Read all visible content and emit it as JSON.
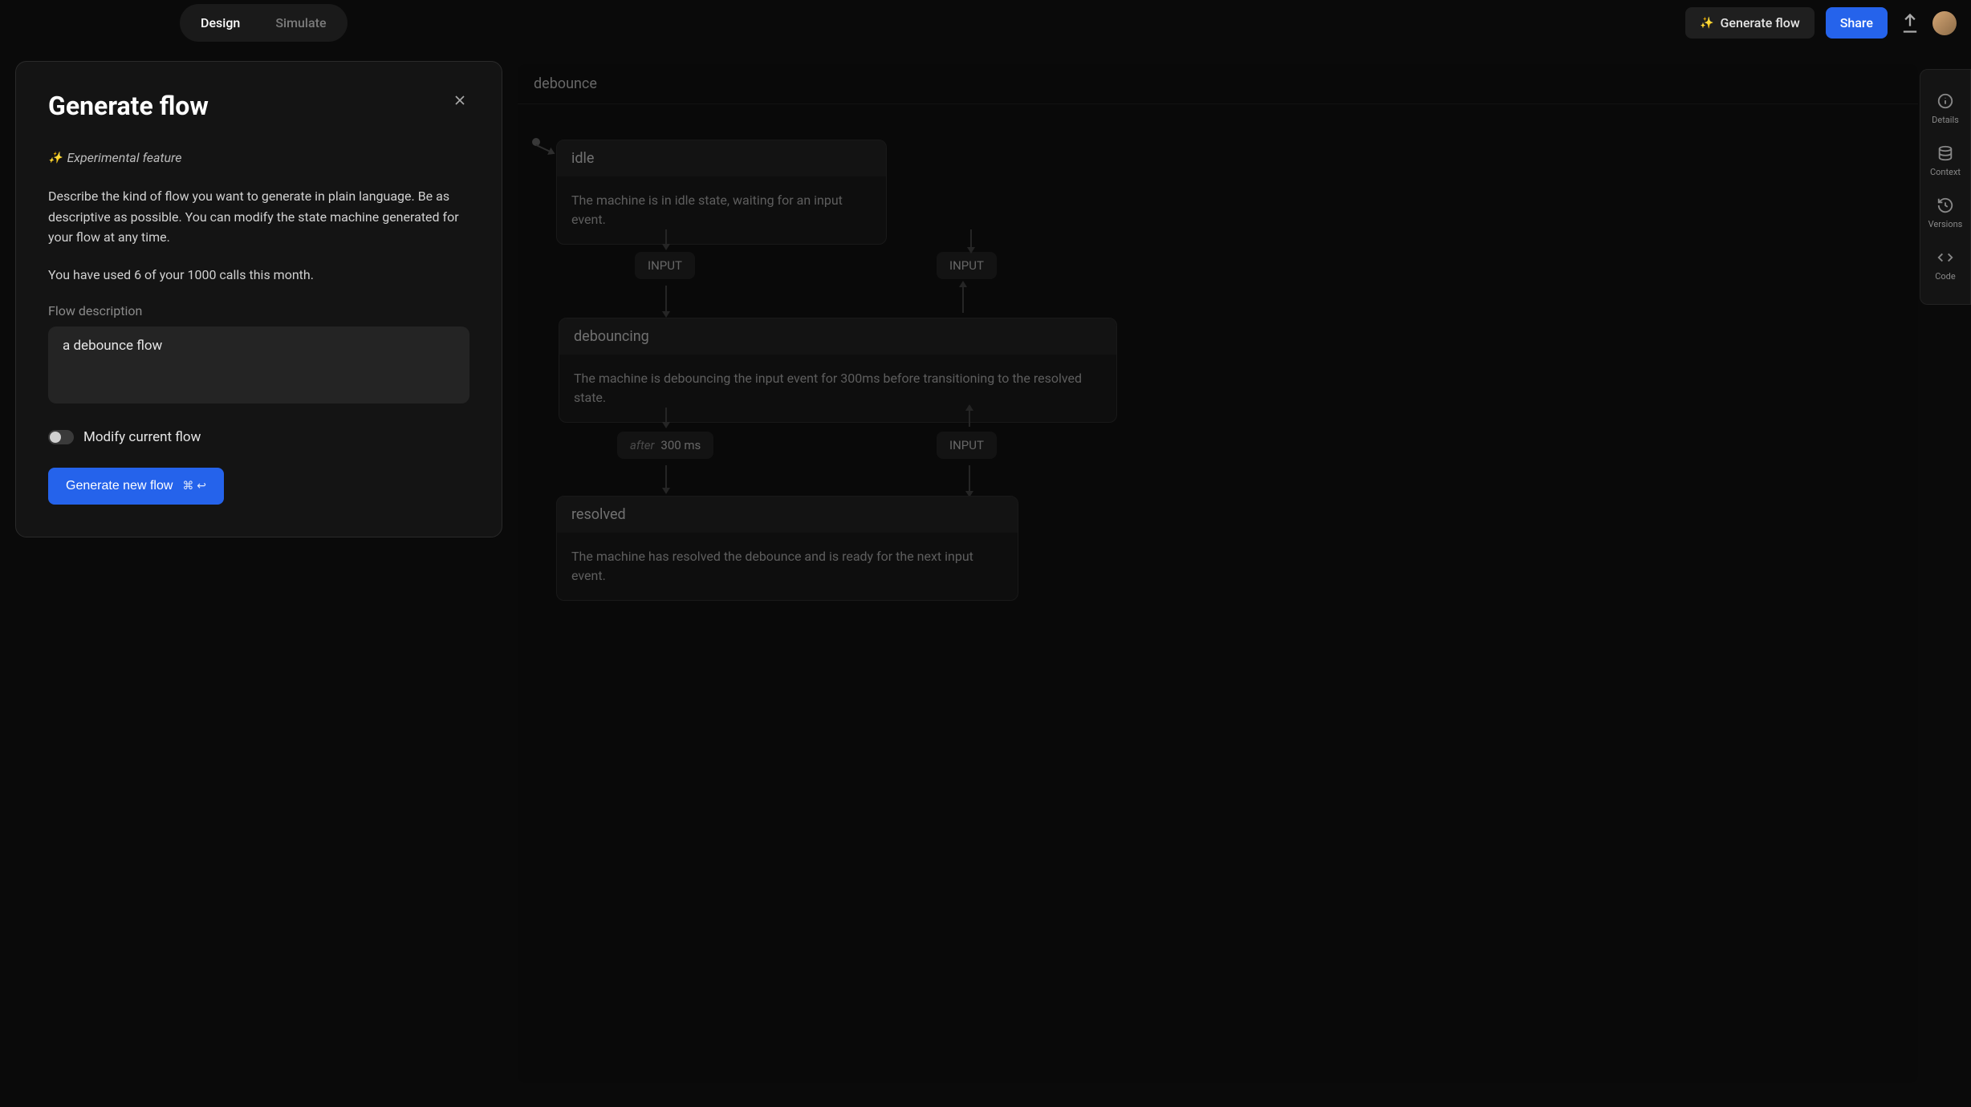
{
  "topbar": {
    "tabs": {
      "design": "Design",
      "simulate": "Simulate"
    },
    "generate_flow": "Generate flow",
    "share": "Share"
  },
  "dialog": {
    "title": "Generate flow",
    "experimental": "Experimental feature",
    "description": "Describe the kind of flow you want to generate in plain language. Be as descriptive as possible. You can modify the state machine generated for your flow at any time.",
    "usage": "You have used 6 of your 1000 calls this month.",
    "flow_description_label": "Flow description",
    "flow_description_value": "a debounce flow",
    "modify_label": "Modify current flow",
    "generate_btn": "Generate new flow",
    "shortcut": "⌘ ↩"
  },
  "machine": {
    "name": "debounce",
    "states": {
      "idle": {
        "name": "idle",
        "desc": "The machine is in idle state, waiting for an input event."
      },
      "debouncing": {
        "name": "debouncing",
        "desc": "The machine is debouncing the input event for 300ms before transitioning to the resolved state."
      },
      "resolved": {
        "name": "resolved",
        "desc": "The machine has resolved the debounce and is ready for the next input event."
      }
    },
    "events": {
      "input": "INPUT"
    },
    "after": {
      "label": "after",
      "value": "300 ms"
    }
  },
  "rail": {
    "details": "Details",
    "context": "Context",
    "versions": "Versions",
    "code": "Code"
  }
}
